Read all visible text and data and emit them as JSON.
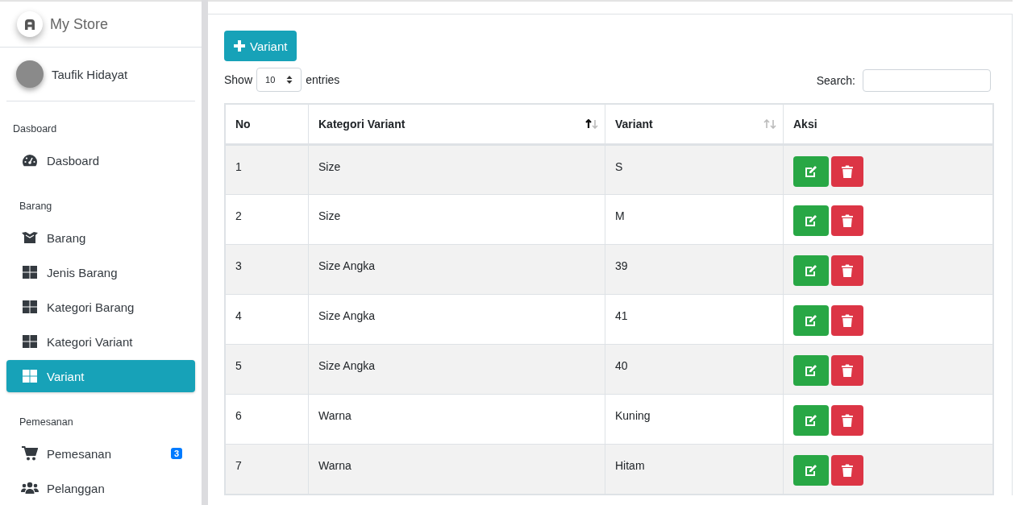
{
  "brand": {
    "title": "My Store"
  },
  "user": {
    "name": "Taufik Hidayat"
  },
  "sidebar": {
    "sections": [
      {
        "header": "Dasboard",
        "items": [
          {
            "label": "Dasboard",
            "kind": "gauge",
            "selected": false
          }
        ]
      },
      {
        "header": "Barang",
        "items": [
          {
            "label": "Barang",
            "kind": "box",
            "selected": false
          },
          {
            "label": "Jenis Barang",
            "kind": "grid",
            "selected": false
          },
          {
            "label": "Kategori Barang",
            "kind": "grid",
            "selected": false
          },
          {
            "label": "Kategori Variant",
            "kind": "grid",
            "selected": false
          },
          {
            "label": "Variant",
            "kind": "grid",
            "selected": true
          }
        ]
      },
      {
        "header": "Pemesanan",
        "items": [
          {
            "label": "Pemesanan",
            "kind": "cart",
            "selected": false,
            "badge": "3"
          },
          {
            "label": "Pelanggan",
            "kind": "users",
            "selected": false
          }
        ]
      }
    ]
  },
  "add_button": {
    "label": "Variant"
  },
  "length": {
    "before": "Show",
    "value": "10",
    "after": "entries"
  },
  "search": {
    "label": "Search:"
  },
  "table": {
    "columns": [
      {
        "label": "No",
        "sortable": false
      },
      {
        "label": "Kategori Variant",
        "sortable": true,
        "sorted_ascending": true
      },
      {
        "label": "Variant",
        "sortable": true,
        "sorted_ascending": false
      },
      {
        "label": "Aksi",
        "sortable": false
      }
    ],
    "rows": [
      [
        "1",
        "Size",
        "S"
      ],
      [
        "2",
        "Size",
        "M"
      ],
      [
        "3",
        "Size Angka",
        "39"
      ],
      [
        "4",
        "Size Angka",
        "41"
      ],
      [
        "5",
        "Size Angka",
        "40"
      ],
      [
        "6",
        "Warna",
        "Kuning"
      ],
      [
        "7",
        "Warna",
        "Hitam"
      ]
    ]
  }
}
